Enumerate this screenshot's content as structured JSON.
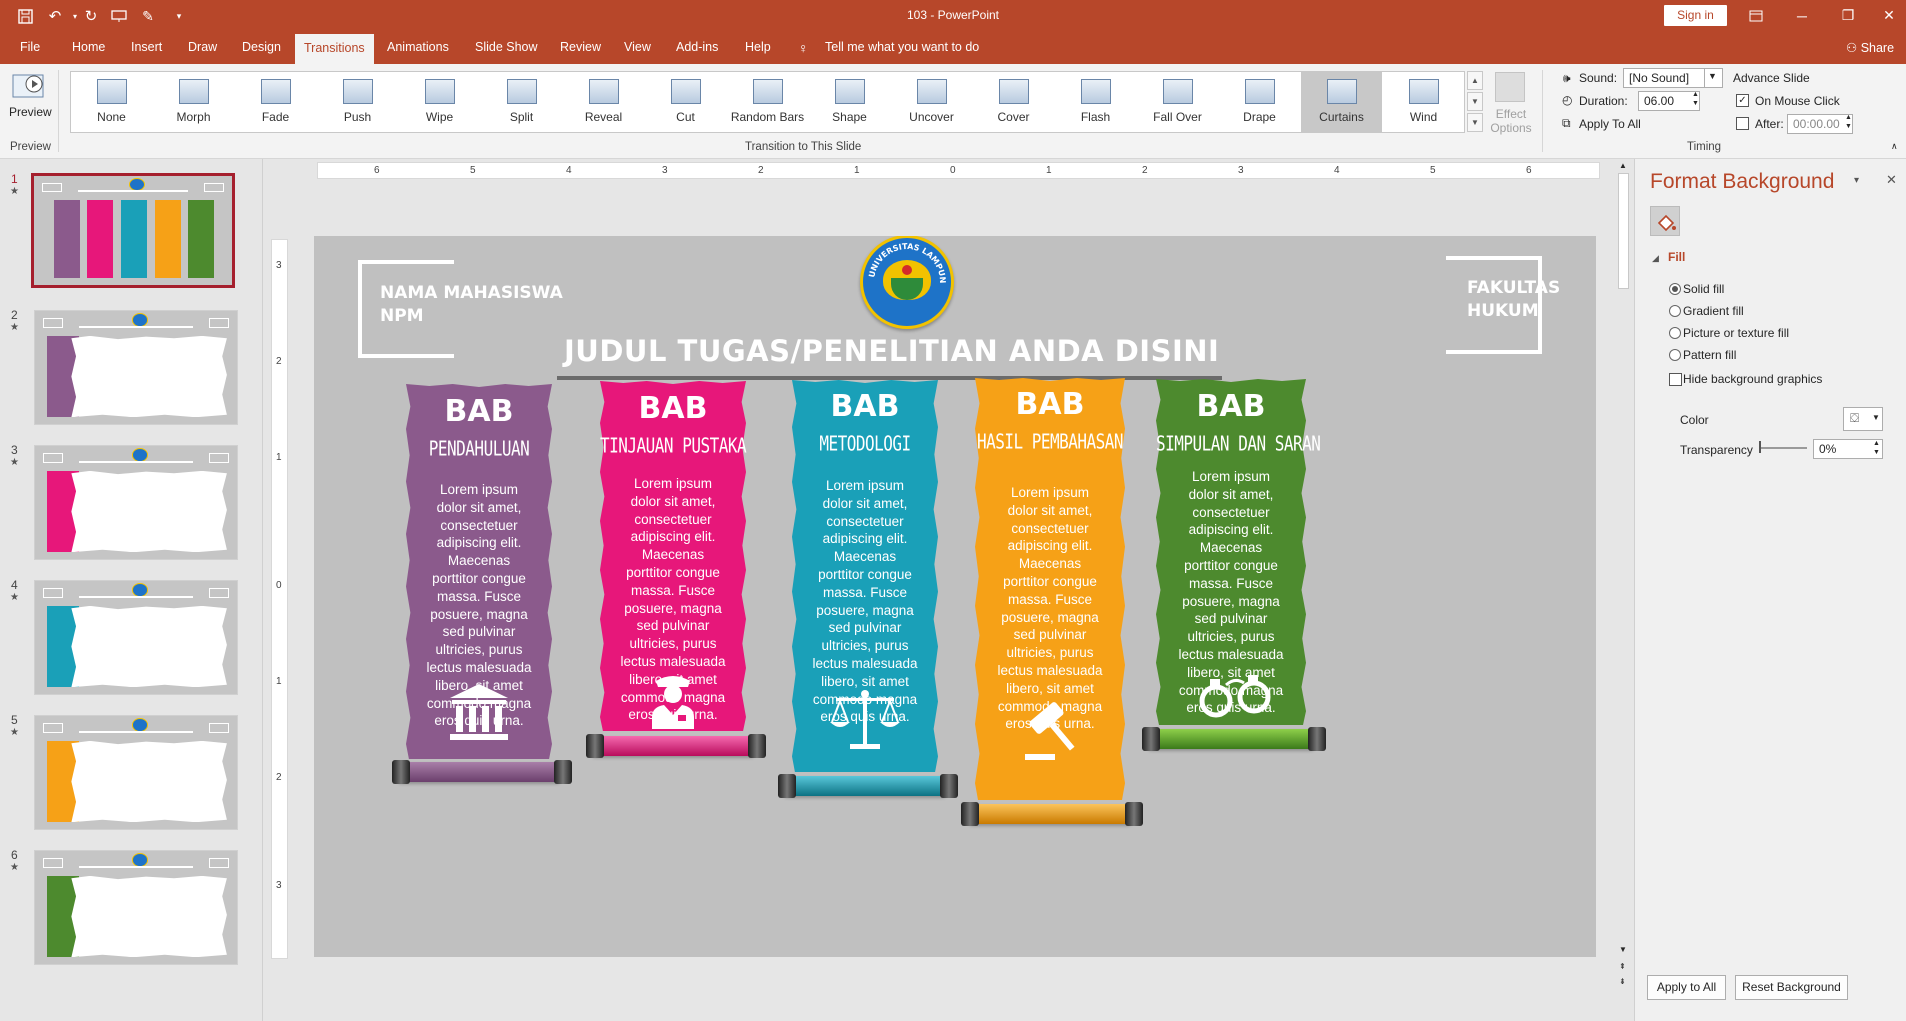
{
  "window": {
    "title": "103 - PowerPoint",
    "signin_label": "Sign in"
  },
  "tabs": {
    "items": [
      "File",
      "Home",
      "Insert",
      "Draw",
      "Design",
      "Transitions",
      "Animations",
      "Slide Show",
      "Review",
      "View",
      "Add-ins",
      "Help"
    ],
    "active": "Transitions",
    "tell_me": "Tell me what you want to do",
    "share": "Share"
  },
  "ribbon": {
    "preview_label": "Preview",
    "preview_group": "Preview",
    "transitions": [
      "None",
      "Morph",
      "Fade",
      "Push",
      "Wipe",
      "Split",
      "Reveal",
      "Cut",
      "Random Bars",
      "Shape",
      "Uncover",
      "Cover",
      "Flash",
      "Fall Over",
      "Drape",
      "Curtains",
      "Wind"
    ],
    "selected_transition": "Curtains",
    "transition_group": "Transition to This Slide",
    "effect_options": "Effect Options",
    "timing_group": "Timing",
    "sound_label": "Sound:",
    "sound_value": "[No Sound]",
    "duration_label": "Duration:",
    "duration_value": "06.00",
    "apply_all": "Apply To All",
    "advance_slide": "Advance Slide",
    "on_mouse_click": "On Mouse Click",
    "on_mouse_click_checked": true,
    "after_label": "After:",
    "after_value": "00:00.00",
    "after_checked": false
  },
  "thumbnails": {
    "numbers": [
      "1",
      "2",
      "3",
      "4",
      "5",
      "6"
    ],
    "colors": [
      "#8b5a8c",
      "#e7177a",
      "#1aa0b8",
      "#f6a117",
      "#4d8a2e"
    ],
    "active": "1"
  },
  "rulers": {
    "horizontal": [
      "6",
      "5",
      "4",
      "3",
      "2",
      "1",
      "0",
      "1",
      "2",
      "3",
      "4",
      "5",
      "6"
    ],
    "vertical": [
      "3",
      "2",
      "1",
      "0",
      "1",
      "2",
      "3"
    ]
  },
  "slide": {
    "left_box": "NAMA MAHASISWA\nNPM",
    "right_box": "FAKULTAS\nHUKUM",
    "title": "JUDUL TUGAS/PENELITIAN ANDA DISINI",
    "logo_text": "UNIVERSITAS LAMPUNG",
    "lorem": "Lorem ipsum dolor sit amet, consectetuer adipiscing elit. Maecenas porttitor congue massa. Fusce posuere, magna sed pulvinar ultricies, purus lectus malesuada libero, sit amet commodo magna eros quis urna.",
    "scrolls": [
      {
        "bab": "BAB",
        "title": "PENDAHULUAN",
        "color": "#8b5a8c",
        "icon": "bank-icon"
      },
      {
        "bab": "BAB",
        "title": "TINJAUAN PUSTAKA",
        "color": "#e7177a",
        "icon": "police-officer-icon"
      },
      {
        "bab": "BAB",
        "title": "METODOLOGI",
        "color": "#1aa0b8",
        "icon": "scales-icon"
      },
      {
        "bab": "BAB",
        "title": "HASIL PEMBAHASAN",
        "color": "#f6a117",
        "icon": "gavel-icon"
      },
      {
        "bab": "BAB",
        "title": "SIMPULAN DAN SARAN",
        "color": "#4d8a2e",
        "icon": "handcuffs-icon"
      }
    ]
  },
  "format_pane": {
    "title": "Format Background",
    "section": "Fill",
    "options": [
      "Solid fill",
      "Gradient fill",
      "Picture or texture fill",
      "Pattern fill"
    ],
    "selected_option": "Solid fill",
    "hide_bg": "Hide background graphics",
    "color_label": "Color",
    "transparency_label": "Transparency",
    "transparency_value": "0%",
    "apply_all": "Apply to All",
    "reset": "Reset Background"
  },
  "colors": {
    "accent": "#b7472a",
    "slide_bg": "#c0c0c0",
    "thumb_active": "#a51f2d"
  }
}
